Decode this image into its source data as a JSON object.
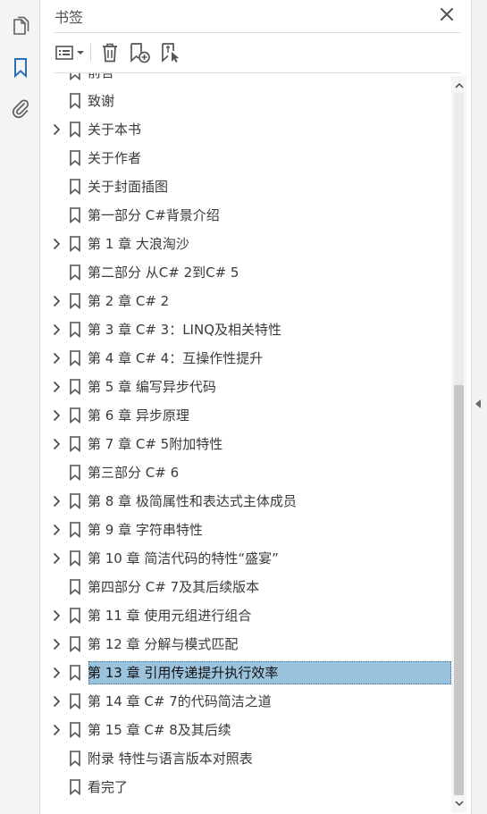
{
  "panel": {
    "title": "书签"
  },
  "rail": {
    "icons": [
      "pages-icon",
      "bookmark-icon",
      "attachment-icon"
    ],
    "active_color": "#2d6fb3"
  },
  "toolbar": {
    "icons": [
      "options-menu-icon",
      "delete-bookmark-icon",
      "new-bookmark-icon",
      "bookmark-from-selection-icon"
    ]
  },
  "bookmarks": [
    {
      "label": "前言",
      "expandable": false
    },
    {
      "label": "致谢",
      "expandable": false
    },
    {
      "label": "关于本书",
      "expandable": true
    },
    {
      "label": "关于作者",
      "expandable": false
    },
    {
      "label": "关于封面插图",
      "expandable": false
    },
    {
      "label": "第一部分 C#背景介绍",
      "expandable": false
    },
    {
      "label": "第 1 章 大浪淘沙",
      "expandable": true
    },
    {
      "label": "第二部分 从C# 2到C# 5",
      "expandable": false
    },
    {
      "label": "第 2 章 C# 2",
      "expandable": true
    },
    {
      "label": "第 3 章 C# 3：LINQ及相关特性",
      "expandable": true
    },
    {
      "label": "第 4 章 C# 4：互操作性提升",
      "expandable": true
    },
    {
      "label": "第 5 章 编写异步代码",
      "expandable": true
    },
    {
      "label": "第 6 章 异步原理",
      "expandable": true
    },
    {
      "label": "第 7 章 C# 5附加特性",
      "expandable": true
    },
    {
      "label": "第三部分 C# 6",
      "expandable": false
    },
    {
      "label": "第 8 章 极简属性和表达式主体成员",
      "expandable": true
    },
    {
      "label": "第 9 章 字符串特性",
      "expandable": true
    },
    {
      "label": "第 10 章 简洁代码的特性“盛宴”",
      "expandable": true
    },
    {
      "label": "第四部分 C# 7及其后续版本",
      "expandable": false
    },
    {
      "label": "第 11 章 使用元组进行组合",
      "expandable": true
    },
    {
      "label": "第 12 章 分解与模式匹配",
      "expandable": true
    },
    {
      "label": "第 13 章 引用传递提升执行效率",
      "expandable": true,
      "selected": true
    },
    {
      "label": "第 14 章 C# 7的代码简洁之道",
      "expandable": true
    },
    {
      "label": "第 15 章 C# 8及其后续",
      "expandable": true
    },
    {
      "label": "附录 特性与语言版本对照表",
      "expandable": false
    },
    {
      "label": "看完了",
      "expandable": false
    }
  ],
  "scrollbar": {
    "position_fraction": 1.0,
    "visible_fraction": 0.74
  },
  "colors": {
    "selection": "#9cc3de",
    "icon": "#5a5a5a"
  }
}
